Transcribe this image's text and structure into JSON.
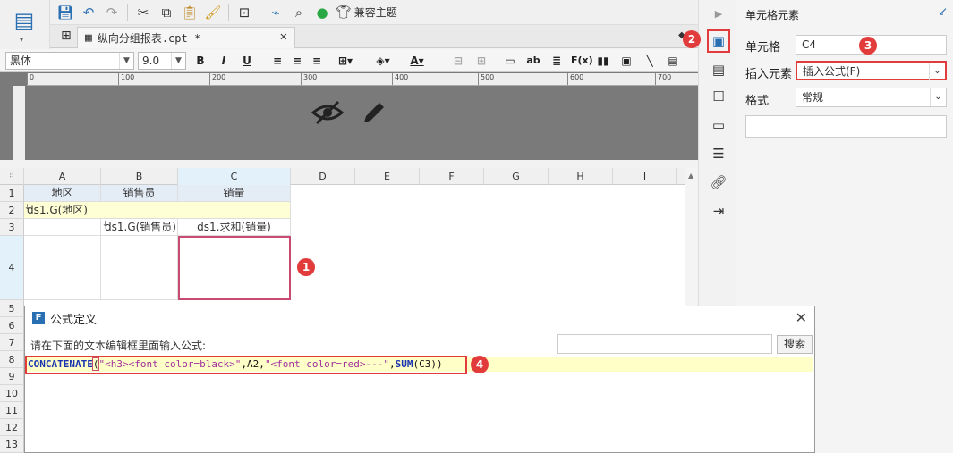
{
  "app": {
    "file_tab": "纵向分组报表.cpt *",
    "theme_label": "兼容主题"
  },
  "format_bar": {
    "font_name": "黑体",
    "font_size": "9.0",
    "bold": "B",
    "italic": "I",
    "underline": "U"
  },
  "ruler": {
    "ticks": [
      "0",
      "100",
      "200",
      "300",
      "400",
      "500",
      "600",
      "700"
    ]
  },
  "sheet": {
    "columns": [
      "A",
      "B",
      "C",
      "D",
      "E",
      "F",
      "G",
      "H",
      "I"
    ],
    "rows": [
      "1",
      "2",
      "3",
      "4",
      "5",
      "6",
      "7",
      "8",
      "9",
      "10",
      "11",
      "12",
      "13"
    ],
    "cells": {
      "A1": "地区",
      "B1": "销售员",
      "C1": "销量",
      "A2": "ds1.G(地区)",
      "B3": "ds1.G(销售员)",
      "C3": "ds1.求和(销量)"
    }
  },
  "panel": {
    "title": "单元格元素",
    "cell_label": "单元格",
    "cell_value": "C4",
    "insert_label": "插入元素",
    "insert_value": "插入公式(F)",
    "format_label": "格式",
    "format_value": "常规"
  },
  "dialog": {
    "title": "公式定义",
    "prompt": "请在下面的文本编辑框里面输入公式:",
    "search_button": "搜索",
    "formula_fn1": "CONCATENATE",
    "formula_open": "(",
    "formula_str1": "\"<h3><font color=black>\"",
    "formula_sep1": ",A2,",
    "formula_str2": "\"<font color=red>---\"",
    "formula_sep2": ",",
    "formula_fn2": "SUM",
    "formula_arg": "(C3)",
    "formula_close": ")"
  },
  "badges": [
    "1",
    "2",
    "3",
    "4"
  ],
  "colors": {
    "accent": "#2b6fb3",
    "annotation": "#e23b3b",
    "formula_highlight": "#ffffc8",
    "selected_col": "#e3f1fb"
  }
}
